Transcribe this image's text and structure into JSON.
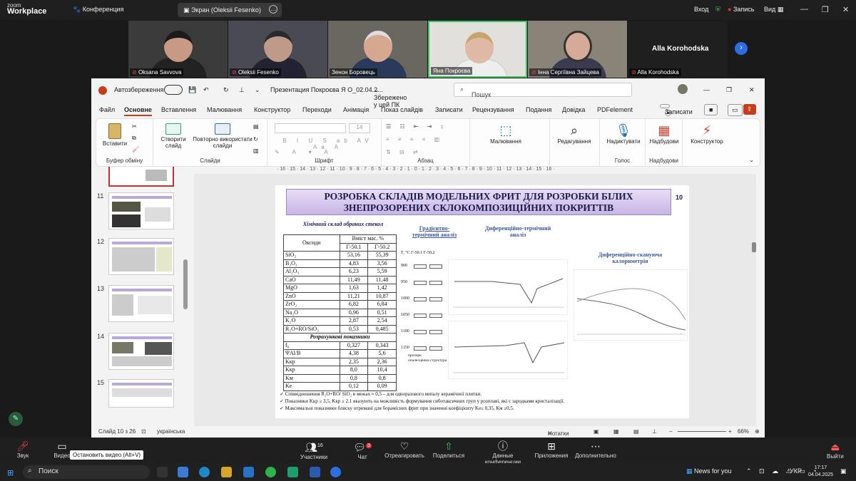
{
  "zoom": {
    "logo_top": "zoom",
    "logo_bottom": "Workplace",
    "meeting_label": "Конференция",
    "share_label": "Экран (Oleksii Fesenko)",
    "login_label": "Вход",
    "record_label": "Запись",
    "view_label": "Вид"
  },
  "participants": [
    {
      "name": "Oksana Savvova",
      "muted": true
    },
    {
      "name": "Oleksii Fesenko",
      "muted": true
    },
    {
      "name": "Зенон Боровець",
      "muted": false
    },
    {
      "name": "Яна Покроєва",
      "muted": false,
      "active": true
    },
    {
      "name": "Інна Сергіївна Зайцева",
      "muted": true
    },
    {
      "name": "Alla Korohodska",
      "muted": true,
      "video": false
    }
  ],
  "big_name": "Alla Korohodska",
  "ppt": {
    "autosave_label": "Автозбереження",
    "file_title": "Презентация Покроєва Я О_02.04.2...",
    "saved_status": "Збережено у цей ПК",
    "search_placeholder": "Пошук",
    "tabs": [
      "Файл",
      "Основне",
      "Вставлення",
      "Малювання",
      "Конструктор",
      "Переходи",
      "Анімація",
      "Показ слайдів",
      "Записати",
      "Рецензування",
      "Подання",
      "Довідка",
      "PDFelement"
    ],
    "record_btn": "Записати",
    "ribbon": {
      "paste": "Вставити",
      "clipboard": "Буфер обміну",
      "new_slide": "Створити слайд",
      "reuse": "Повторно використати слайди",
      "slides": "Слайди",
      "font": "Шрифт",
      "font_size": "14",
      "paragraph": "Абзац",
      "drawing": "Малювання",
      "editing": "Редагування",
      "dictate": "Надиктувати",
      "voice": "Голос",
      "addins": "Надбудови",
      "addins_group": "Надбудови",
      "designer": "Конструктор"
    },
    "ruler": "· 16 · 15 · 14 · 13 · 12 · 11 · 10 · 9 · 8 · 7 · 6 · 5 · 4 · 3 · 2 · 1 · 0 · 1 · 2 · 3 · 4 · 5 · 6 · 7 · 8 · 9 · 10 · 11 · 12 · 13 · 14 · 15 · 16 ·",
    "thumb_numbers": [
      "11",
      "12",
      "13",
      "14",
      "15"
    ],
    "status_slide": "Слайд 10 з 26",
    "status_lang": "українська",
    "notes_label": "Нотатки",
    "zoom_pct": "66%"
  },
  "slide": {
    "title_line1": "РОЗРОБКА СКЛАДІВ МОДЕЛЬНИХ ФРИТ ДЛЯ РОЗРОБКИ БІЛИХ",
    "title_line2": "ЗНЕПРОЗОРЕНИХ СКЛОКОМПОЗИЦІЙНИХ ПОКРИТТІВ",
    "number": "10",
    "table_title": "Хімічний склад обраних стекол",
    "col_oxides": "Оксиди",
    "col_content": "Вміст мас. %",
    "col_g1": "Г-50.1",
    "col_g2": "Г-50.2",
    "rows": [
      [
        "SiO₂",
        "53,16",
        "55,39"
      ],
      [
        "B₂O₃",
        "4,83",
        "3,56"
      ],
      [
        "Al₂O₃",
        "6,23",
        "5,59"
      ],
      [
        "CaO",
        "11,49",
        "11,48"
      ],
      [
        "MgO",
        "1,63",
        "1,42"
      ],
      [
        "ZnO",
        "11,21",
        "10,87"
      ],
      [
        "ZrO₂",
        "6,82",
        "6,84"
      ],
      [
        "Na₂O",
        "0,96",
        "0,51"
      ],
      [
        "K₂O",
        "2,87",
        "2,54"
      ],
      [
        "R₂O+RO/SiO₂",
        "0,53",
        "0,485"
      ]
    ],
    "calc_label": "Розрахункові показники",
    "calc_rows": [
      [
        "f₀",
        "0,327",
        "0,343"
      ],
      [
        "ΨAl/B",
        "4,38",
        "5,6"
      ],
      [
        "Kкр",
        "2,35",
        "2,36"
      ],
      [
        "Kкр",
        "8,0",
        "10,4"
      ],
      [
        "Kм",
        "0,8",
        "0,8"
      ],
      [
        "Kе",
        "0,12",
        "0,09"
      ]
    ],
    "h_grad": "Градієнтно-термічний аналіз",
    "h_dta": "Диференційно-термічний аналіз",
    "h_dsc": "Диференційно-скануюча калориметрія",
    "grad_header": "T, °C   Г-50.1   Г-50.2",
    "grad_temps": [
      "900",
      "950",
      "1000",
      "1050",
      "1100",
      "1150"
    ],
    "legend_1": "прозоре,",
    "legend_2": "опалесценна структура",
    "note1": "Співвідношення R₂O+RO/ SiO₂ в межах ≈ 0,5 – для одноразового випалу керамічної плитки.",
    "note2": "Показники Kкр ≥ 3,5, Kкр ≥ 2,1 вказують на можливість формування сиботаксичних груп у розплаві, які є зародками кристалізації.",
    "note3": "Максимальні показники блиску отримані для борамісних фрит при значенні коефіцієнту Ke≤ 0,35, Км ≥0,5."
  },
  "bottom": {
    "sound": "Звук",
    "video": "Видео",
    "tooltip": "Остановить видео (Alt+V)",
    "participants": "Участники",
    "participants_count": "16",
    "chat": "Чат",
    "chat_badge": "3",
    "react": "Отреагировать",
    "share": "Поделиться",
    "info": "Данные конференции",
    "apps": "Приложения",
    "more": "Дополнительно",
    "leave": "Выйти"
  },
  "taskbar": {
    "search": "Поиск",
    "news": "News for you",
    "lang": "УКР",
    "time": "17:17",
    "date": "04.04.2025"
  }
}
